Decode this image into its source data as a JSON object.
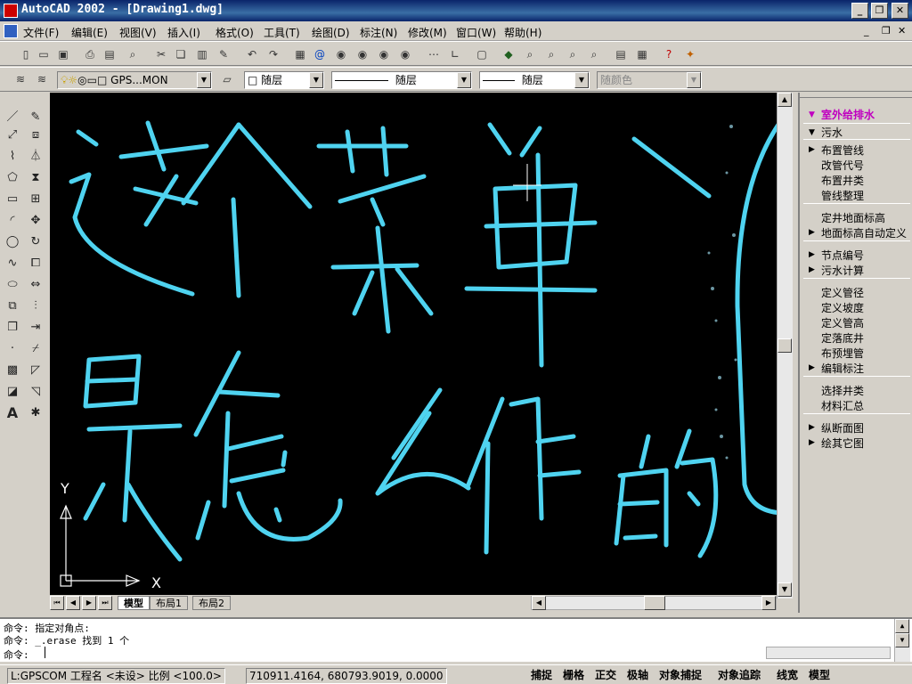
{
  "window": {
    "title": "AutoCAD 2002 - [Drawing1.dwg]"
  },
  "menu": {
    "items": [
      "文件(F)",
      "编辑(E)",
      "视图(V)",
      "插入(I)",
      "格式(O)",
      "工具(T)",
      "绘图(D)",
      "标注(N)",
      "修改(M)",
      "窗口(W)",
      "帮助(H)"
    ]
  },
  "properties": {
    "layer": "GPS...MON",
    "color": "随层",
    "linetype_label": "随层",
    "lineweight_label": "随层",
    "plotstyle": "随颜色"
  },
  "canvas": {
    "ucs_x": "X",
    "ucs_y": "Y"
  },
  "layout_tabs": [
    "模型",
    "布局1",
    "布局2"
  ],
  "right_panel": {
    "title": "室外给排水",
    "section": "污水",
    "items": [
      {
        "label": "布置管线",
        "arrow": true
      },
      {
        "label": "改管代号",
        "arrow": false
      },
      {
        "label": "布置井类",
        "arrow": false
      },
      {
        "label": "管线整理",
        "arrow": false
      },
      {
        "label": "定井地面标高",
        "arrow": false
      },
      {
        "label": "地面标高自动定义",
        "arrow": true
      },
      {
        "label": "节点编号",
        "arrow": true
      },
      {
        "label": "污水计算",
        "arrow": true
      },
      {
        "label": "定义管径",
        "arrow": false
      },
      {
        "label": "定义坡度",
        "arrow": false
      },
      {
        "label": "定义管高",
        "arrow": false
      },
      {
        "label": "定落底井",
        "arrow": false
      },
      {
        "label": "布预埋管",
        "arrow": false
      },
      {
        "label": "编辑标注",
        "arrow": true
      },
      {
        "label": "选择井类",
        "arrow": false
      },
      {
        "label": "材料汇总",
        "arrow": false
      },
      {
        "label": "纵断面图",
        "arrow": true
      },
      {
        "label": "绘其它图",
        "arrow": true
      }
    ]
  },
  "command": {
    "history": [
      "命令: 指定对角点:",
      "命令: _.erase 找到 1 个"
    ],
    "prompt": "命令:"
  },
  "status": {
    "info": "L:GPSCOM 工程名 <未设> 比例 <100.0>",
    "coords": "710911.4164, 680793.9019, 0.0000",
    "modes": [
      "捕捉",
      "栅格",
      "正交",
      "极轴",
      "对象捕捉",
      "对象追踪",
      "线宽",
      "模型"
    ]
  },
  "colors": {
    "ink": "#4fd3f0",
    "canvas": "#000000",
    "title_bar": "#0a246a",
    "panel_title": "#c000c0"
  },
  "icons": [
    "line-icon",
    "xline-icon",
    "pline-icon",
    "polygon-icon",
    "rectangle-icon",
    "arc-icon",
    "circle-icon",
    "spline-icon",
    "ellipse-icon",
    "insert-block-icon",
    "make-block-icon",
    "point-icon",
    "hatch-icon",
    "region-icon",
    "text-icon",
    "erase-icon",
    "copy-icon",
    "mirror-icon",
    "offset-icon",
    "array-icon",
    "move-icon",
    "rotate-icon",
    "scale-icon",
    "stretch-icon",
    "trim-icon",
    "extend-icon",
    "break-icon",
    "chamfer-icon",
    "fillet-icon",
    "explode-icon"
  ]
}
